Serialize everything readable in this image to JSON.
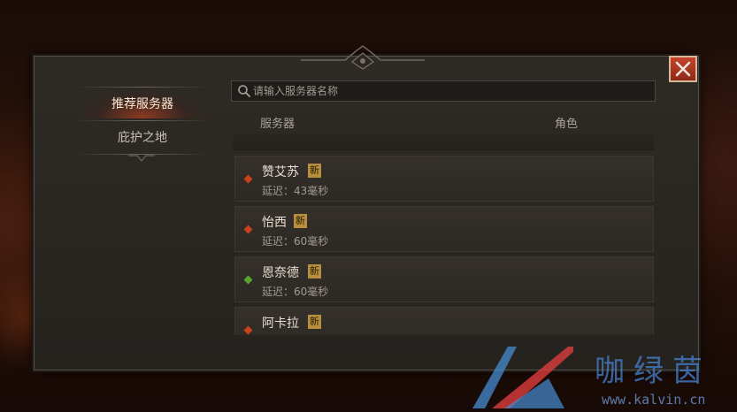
{
  "nav": {
    "items": [
      {
        "label": "推荐服务器",
        "active": true
      },
      {
        "label": "庇护之地",
        "active": false
      }
    ]
  },
  "search": {
    "placeholder": "请输入服务器名称",
    "value": ""
  },
  "table": {
    "columns": [
      "服务器",
      "角色"
    ]
  },
  "servers": [
    {
      "name": "赞艾苏",
      "badge": "新",
      "latency": "延迟：43毫秒",
      "status_color": "#c8421c"
    },
    {
      "name": "怡西",
      "badge": "新",
      "latency": "延迟：60毫秒",
      "status_color": "#c8421c"
    },
    {
      "name": "恩奈德",
      "badge": "新",
      "latency": "延迟：60毫秒",
      "status_color": "#5aa52d"
    },
    {
      "name": "阿卡拉",
      "badge": "新",
      "latency": "",
      "status_color": "#c8421c"
    }
  ],
  "watermark": {
    "text": "咖绿茵",
    "url": "www.kalvin.cn"
  },
  "colors": {
    "accent_red": "#c5442b",
    "badge_gold": "#b88f3c"
  },
  "icons": {
    "close": "close-icon",
    "search": "search-icon"
  }
}
